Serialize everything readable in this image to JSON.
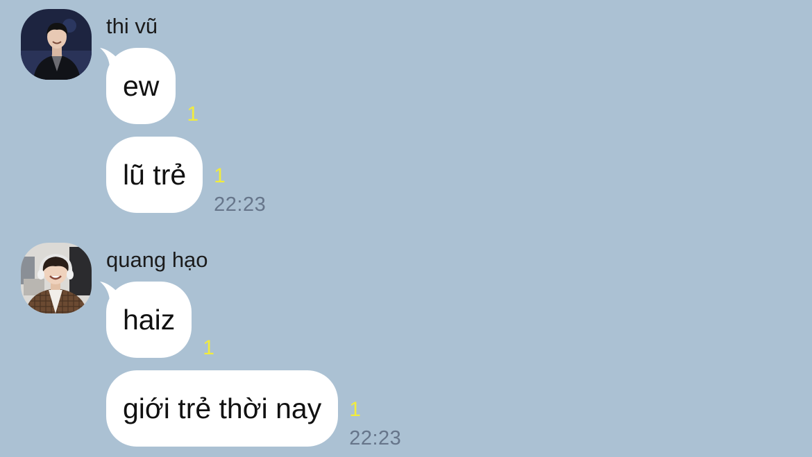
{
  "colors": {
    "background": "#abc1d3",
    "bubble": "#ffffff",
    "unread_count": "#f2ec3c",
    "timestamp": "#66758a"
  },
  "conversation": [
    {
      "sender": "thi vũ",
      "avatar_icon": "profile-photo-man-dark-suit",
      "messages": [
        {
          "text": "ew",
          "unread": "1",
          "time": ""
        },
        {
          "text": "lũ trẻ",
          "unread": "1",
          "time": "22:23"
        }
      ]
    },
    {
      "sender": "quang hạo",
      "avatar_icon": "profile-photo-smiling-man-headphones",
      "messages": [
        {
          "text": "haiz",
          "unread": "1",
          "time": ""
        },
        {
          "text": "giới trẻ thời nay",
          "unread": "1",
          "time": "22:23"
        }
      ]
    }
  ]
}
